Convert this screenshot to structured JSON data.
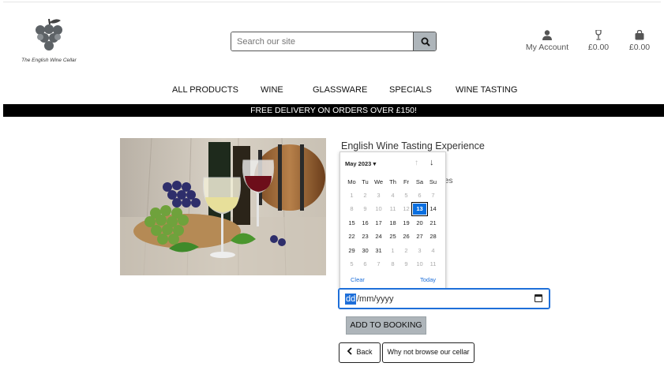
{
  "brand": {
    "logo_text": "The English Wine Cellar"
  },
  "search": {
    "placeholder": "Search our site",
    "icon": "magnifier"
  },
  "header": {
    "account_label": "My Account",
    "wishlist_total": "£0.00",
    "bag_total": "£0.00"
  },
  "nav": {
    "items": [
      "ALL PRODUCTS",
      "WINE",
      "GLASSWARE",
      "SPECIALS",
      "WINE TASTING"
    ]
  },
  "banner": {
    "text": "FREE DELIVERY ON ORDERS OVER £150!"
  },
  "product": {
    "title": "English Wine Tasting Experience",
    "peek_text": "es"
  },
  "calendar": {
    "month_label": "May 2023 ▾",
    "up_arrow": "↑",
    "down_arrow": "↓",
    "weekdays": [
      "Mo",
      "Tu",
      "We",
      "Th",
      "Fr",
      "Sa",
      "Su"
    ],
    "weeks": [
      [
        "1",
        "2",
        "3",
        "4",
        "5",
        "6",
        "7"
      ],
      [
        "8",
        "9",
        "10",
        "11",
        "12",
        "13",
        "14"
      ],
      [
        "15",
        "16",
        "17",
        "18",
        "19",
        "20",
        "21"
      ],
      [
        "22",
        "23",
        "24",
        "25",
        "26",
        "27",
        "28"
      ],
      [
        "29",
        "30",
        "31",
        "1",
        "2",
        "3",
        "4"
      ],
      [
        "5",
        "6",
        "7",
        "8",
        "9",
        "10",
        "11"
      ]
    ],
    "selected_day": "13",
    "clear_label": "Clear",
    "today_label": "Today",
    "accent_color": "#0a6fe0"
  },
  "date_input": {
    "segment_day": "dd",
    "rest": "/mm/yyyy"
  },
  "buttons": {
    "add_to_booking": "ADD TO BOOKING",
    "back": "Back",
    "browse": "Why not browse our cellar"
  },
  "colors": {
    "banner_bg": "#000000",
    "button_grey": "#aeb5ba",
    "focus_blue": "#1e6fd9"
  }
}
